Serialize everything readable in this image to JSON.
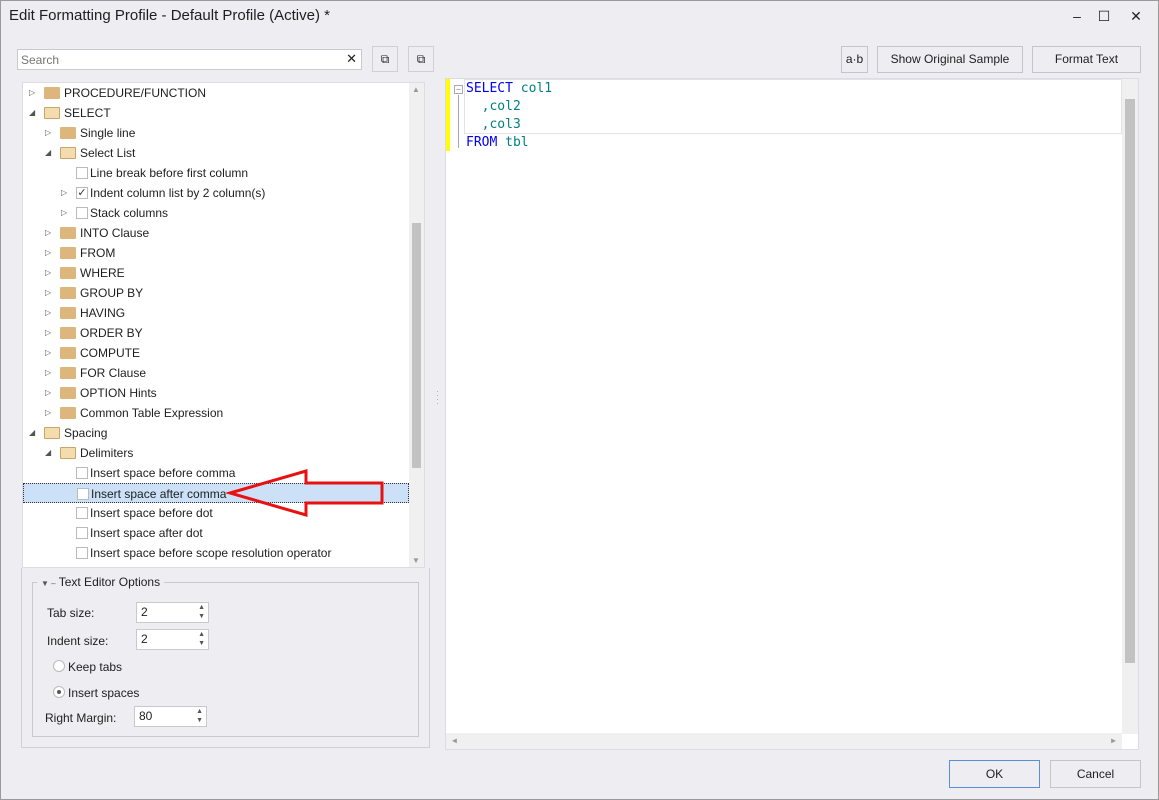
{
  "window": {
    "title": "Edit Formatting Profile - Default Profile (Active) *",
    "minimize": "–",
    "maximize": "☐",
    "close": "✕"
  },
  "search": {
    "placeholder": "Search",
    "value": "",
    "clear": "✕"
  },
  "toolbar": {
    "expand_all": "⧉",
    "collapse_all": "⧉",
    "ab_label": "a·b",
    "show_original": "Show Original Sample",
    "format_text": "Format Text"
  },
  "tree": [
    {
      "label": "PROCEDURE/FUNCTION",
      "level": 0,
      "kind": "folder",
      "expander": "collapsed"
    },
    {
      "label": "SELECT",
      "level": 0,
      "kind": "folder",
      "expander": "expanded"
    },
    {
      "label": "Single line",
      "level": 1,
      "kind": "folder",
      "expander": "collapsed"
    },
    {
      "label": "Select List",
      "level": 1,
      "kind": "folder",
      "expander": "expanded"
    },
    {
      "label": "Line break before first column",
      "level": 2,
      "kind": "check",
      "checked": false
    },
    {
      "label": "Indent column list by 2 column(s)",
      "level": 2,
      "kind": "check",
      "checked": true,
      "expander": "collapsed"
    },
    {
      "label": "Stack columns",
      "level": 2,
      "kind": "check",
      "checked": false,
      "expander": "collapsed"
    },
    {
      "label": "INTO Clause",
      "level": 1,
      "kind": "folder",
      "expander": "collapsed"
    },
    {
      "label": "FROM",
      "level": 1,
      "kind": "folder",
      "expander": "collapsed"
    },
    {
      "label": "WHERE",
      "level": 1,
      "kind": "folder",
      "expander": "collapsed"
    },
    {
      "label": "GROUP BY",
      "level": 1,
      "kind": "folder",
      "expander": "collapsed"
    },
    {
      "label": "HAVING",
      "level": 1,
      "kind": "folder",
      "expander": "collapsed"
    },
    {
      "label": "ORDER BY",
      "level": 1,
      "kind": "folder",
      "expander": "collapsed"
    },
    {
      "label": "COMPUTE",
      "level": 1,
      "kind": "folder",
      "expander": "collapsed"
    },
    {
      "label": "FOR Clause",
      "level": 1,
      "kind": "folder",
      "expander": "collapsed"
    },
    {
      "label": "OPTION Hints",
      "level": 1,
      "kind": "folder",
      "expander": "collapsed"
    },
    {
      "label": "Common Table Expression",
      "level": 1,
      "kind": "folder",
      "expander": "collapsed"
    },
    {
      "label": "Spacing",
      "level": 0,
      "kind": "folder",
      "expander": "expanded"
    },
    {
      "label": "Delimiters",
      "level": 1,
      "kind": "folder",
      "expander": "expanded"
    },
    {
      "label": "Insert space before comma",
      "level": 2,
      "kind": "check",
      "checked": false
    },
    {
      "label": "Insert space after comma",
      "level": 2,
      "kind": "check",
      "checked": false,
      "selected": true
    },
    {
      "label": "Insert space before dot",
      "level": 2,
      "kind": "check",
      "checked": false
    },
    {
      "label": "Insert space after dot",
      "level": 2,
      "kind": "check",
      "checked": false
    },
    {
      "label": "Insert space before scope resolution operator",
      "level": 2,
      "kind": "check",
      "checked": false
    }
  ],
  "options": {
    "title": "Text Editor Options",
    "tab_size_label": "Tab size:",
    "tab_size": "2",
    "indent_size_label": "Indent size:",
    "indent_size": "2",
    "keep_tabs": "Keep tabs",
    "insert_spaces": "Insert spaces",
    "selected_mode": "insert_spaces",
    "right_margin_label": "Right Margin:",
    "right_margin": "80"
  },
  "editor": {
    "lines": [
      [
        {
          "t": "SELECT",
          "c": "kw"
        },
        {
          "t": " col1",
          "c": "id"
        }
      ],
      [
        {
          "t": "  ,",
          "c": "id"
        },
        {
          "t": "col2",
          "c": "id"
        }
      ],
      [
        {
          "t": "  ,",
          "c": "id"
        },
        {
          "t": "col3",
          "c": "id"
        }
      ],
      [
        {
          "t": "FROM",
          "c": "kw"
        },
        {
          "t": " tbl",
          "c": "id"
        }
      ]
    ]
  },
  "footer": {
    "ok": "OK",
    "cancel": "Cancel"
  },
  "colors": {
    "keyword": "#0000ff",
    "identifier": "#008080",
    "selection": "#cce0f7",
    "arrow": "#e81010",
    "change_bar": "#ffff00"
  }
}
